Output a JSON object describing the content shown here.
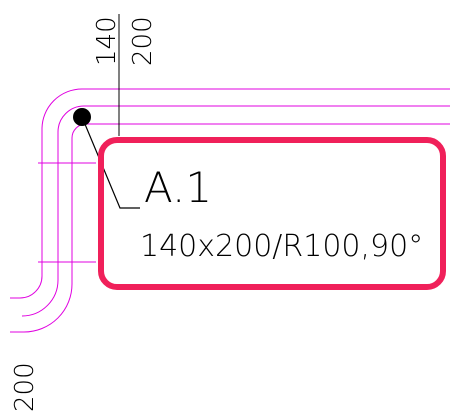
{
  "drawing": {
    "dimension_top_left": "140",
    "dimension_top_right": "200",
    "dimension_bottom": "200",
    "tag_label": "A.1",
    "tag_description": "140x200/R100,90°"
  },
  "colors": {
    "duct_line": "#e000e0",
    "highlight_box": "#f0205a",
    "leader": "#000000",
    "text": "#000000",
    "background": "#ffffff"
  }
}
